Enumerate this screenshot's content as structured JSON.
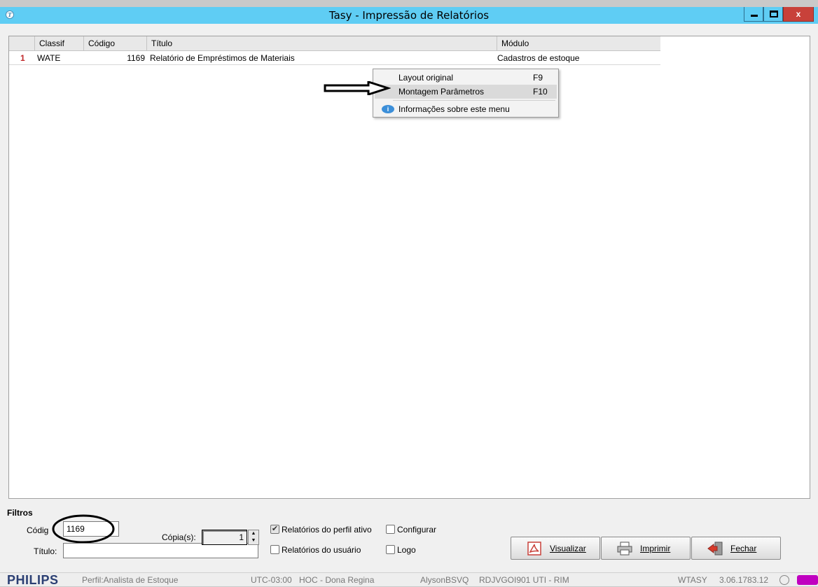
{
  "window": {
    "title": "Tasy - Impressão de Relatórios",
    "app_icon_glyph": "T",
    "close_glyph": "x"
  },
  "grid": {
    "columns": [
      "Classif",
      "Código",
      "Título",
      "Módulo"
    ],
    "rows": [
      {
        "num": "1",
        "classif": "WATE",
        "codigo": "1169",
        "titulo": "Relatório de Empréstimos de Materiais",
        "modulo": "Cadastros de estoque"
      }
    ]
  },
  "context_menu": {
    "items": [
      {
        "label": "Layout original",
        "key": "F9"
      },
      {
        "label": "Montagem Parâmetros",
        "key": "F10",
        "highlighted": true
      },
      {
        "label": "Informações sobre este menu",
        "icon": "info-bubble-icon"
      }
    ]
  },
  "filtros": {
    "title": "Filtros",
    "codigo_label": "Códig",
    "codigo_value": "1169",
    "titulo_label": "Título:",
    "titulo_value": "",
    "copias_label": "Cópia(s):",
    "copias_value": "1",
    "chk_perfil_label": "Relatórios do perfil ativo",
    "chk_perfil_checked": true,
    "chk_usuario_label": "Relatórios do usuário",
    "chk_usuario_checked": false,
    "chk_configurar_label": "Configurar",
    "chk_configurar_checked": false,
    "chk_logo_label": "Logo",
    "chk_logo_checked": false
  },
  "buttons": {
    "visualizar": "Visualizar",
    "imprimir": "Imprimir",
    "fechar": "Fechar"
  },
  "status": {
    "brand": "PHILIPS",
    "perfil": "Perfil:Analista de Estoque",
    "timezone": "UTC-03:00",
    "estabelecimento": "HOC - Dona Regina",
    "usuario": "AlysonBSVQ",
    "maquina": "RDJVGOI901 UTI - RIM",
    "sistema": "WTASY",
    "versao": "3.06.1783.12"
  },
  "colors": {
    "titlebar": "#5fcdf4",
    "close_button": "#c8413a",
    "row_number": "#c0282a",
    "status_indicator": "#c000c0"
  }
}
